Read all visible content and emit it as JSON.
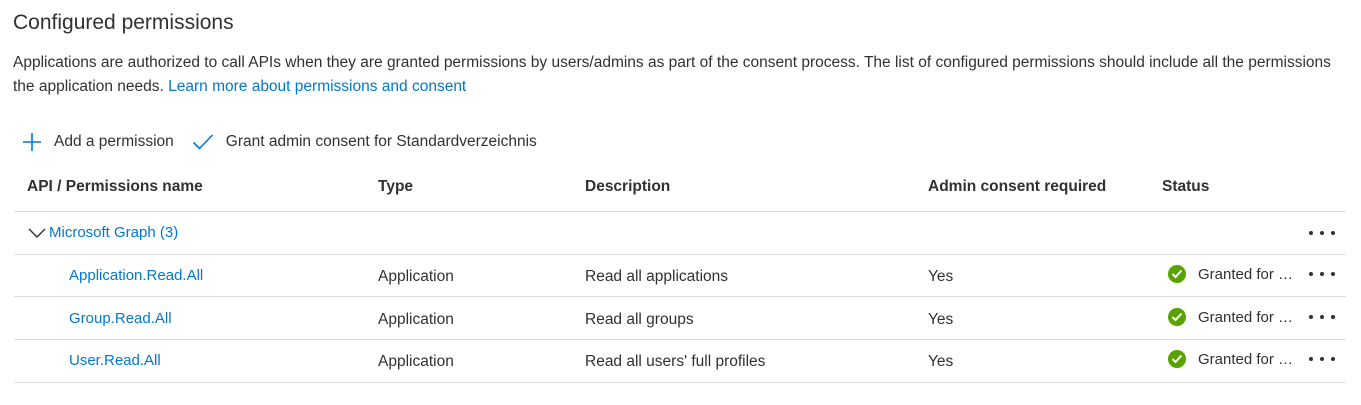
{
  "title": "Configured permissions",
  "description": {
    "text": "Applications are authorized to call APIs when they are granted permissions by users/admins as part of the consent process. The list of configured permissions should include all the permissions the application needs.",
    "link": "Learn more about permissions and consent"
  },
  "toolbar": {
    "add_permission": "Add a permission",
    "grant_consent": "Grant admin consent for Standardverzeichnis"
  },
  "table": {
    "headers": {
      "name": "API / Permissions name",
      "type": "Type",
      "description": "Description",
      "admin_consent": "Admin consent required",
      "status": "Status"
    },
    "group": {
      "label": "Microsoft Graph (3)"
    },
    "rows": [
      {
        "name": "Application.Read.All",
        "type": "Application",
        "description": "Read all applications",
        "admin_consent": "Yes",
        "status": "Granted for Standardverzeichnis"
      },
      {
        "name": "Group.Read.All",
        "type": "Application",
        "description": "Read all groups",
        "admin_consent": "Yes",
        "status": "Granted for Standardverzeichnis"
      },
      {
        "name": "User.Read.All",
        "type": "Application",
        "description": "Read all users' full profiles",
        "admin_consent": "Yes",
        "status": "Granted for Standardverzeichnis"
      }
    ]
  },
  "colors": {
    "accent": "#0078d4",
    "success": "#57a300",
    "divider": "#e1dfdd",
    "text": "#323130"
  },
  "icons": {
    "add": "plus-icon",
    "grant": "checkmark-icon",
    "expand": "chevron-down-icon",
    "more": "more-icon",
    "status": "success-check-icon"
  }
}
